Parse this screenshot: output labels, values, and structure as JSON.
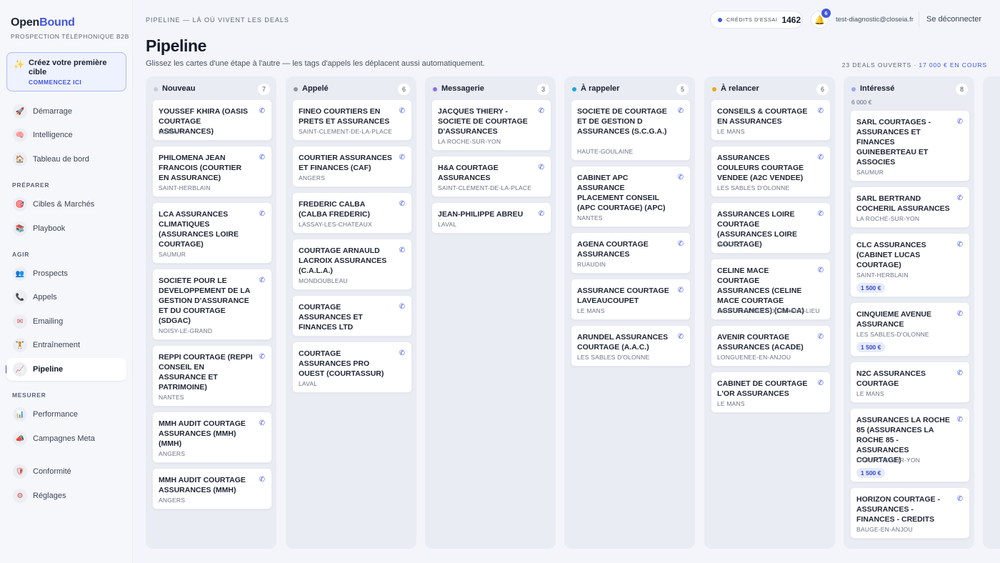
{
  "app": {
    "brand_part1": "Open",
    "brand_part2": "Bound",
    "tagline": "PROSPECTION TÉLÉPHONIQUE B2B"
  },
  "promo": {
    "title": "Créez votre première cible",
    "cta": "COMMENCEZ ICI",
    "icon": "sparkles-icon"
  },
  "sidebar": {
    "top_items": [
      {
        "label": "Démarrage",
        "icon": "rocket-icon"
      },
      {
        "label": "Intelligence",
        "icon": "brain-icon"
      },
      {
        "label": "Tableau de bord",
        "icon": "home-icon"
      }
    ],
    "sections": [
      {
        "label": "PRÉPARER",
        "items": [
          {
            "label": "Cibles & Marchés",
            "icon": "target-icon"
          },
          {
            "label": "Playbook",
            "icon": "books-icon"
          }
        ]
      },
      {
        "label": "AGIR",
        "items": [
          {
            "label": "Prospects",
            "icon": "people-icon"
          },
          {
            "label": "Appels",
            "icon": "phone-icon"
          },
          {
            "label": "Emailing",
            "icon": "envelope-icon"
          },
          {
            "label": "Entraînement",
            "icon": "dumbbell-icon"
          },
          {
            "label": "Pipeline",
            "icon": "chart-up-icon"
          }
        ]
      },
      {
        "label": "MESURER",
        "items": [
          {
            "label": "Performance",
            "icon": "bar-chart-icon"
          },
          {
            "label": "Campagnes Meta",
            "icon": "megaphone-icon"
          }
        ]
      }
    ],
    "bottom_items": [
      {
        "label": "Conformité",
        "icon": "shield-icon"
      },
      {
        "label": "Réglages",
        "icon": "gear-icon"
      }
    ]
  },
  "header": {
    "breadcrumb": "PIPELINE — LÀ OÙ VIVENT LES DEALS",
    "credits_label": "CRÉDITS D'ESSAI",
    "credits_value": "1462",
    "notifications_count": "6",
    "user_email": "test-diagnostic@closeia.fr",
    "logout": "Se déconnecter"
  },
  "page": {
    "title": "Pipeline",
    "subtitle": "Glissez les cartes d'une étape à l'autre — les tags d'appels les déplacent aussi automatiquement.",
    "summary_count": "23 DEALS OUVERTS · ",
    "summary_amount": "17 000 € EN COURS"
  },
  "columns": [
    {
      "name": "Nouveau",
      "count": "7",
      "color": "#c9cdd8",
      "cards": [
        {
          "title": "YOUSSEF KHIRA (OASIS COURTAGE ASSURANCES)",
          "city": "LE MANS"
        },
        {
          "title": "PHILOMENA JEAN FRANCOIS (COURTIER EN ASSURANCE)",
          "city": "SAINT-HERBLAIN"
        },
        {
          "title": "LCA ASSURANCES CLIMATIQUES (ASSURANCES LOIRE COURTAGE)",
          "city": "SAUMUR"
        },
        {
          "title": "SOCIETE POUR LE DEVELOPPEMENT DE LA GESTION D'ASSURANCE ET DU COURTAGE (SDGAC)",
          "city": "NOISY-LE-GRAND"
        },
        {
          "title": "REPPI COURTAGE (REPPI CONSEIL EN ASSURANCE ET PATRIMOINE)",
          "city": "NANTES"
        },
        {
          "title": "MMH AUDIT COURTAGE ASSURANCES (MMH) (MMH)",
          "city": "ANGERS"
        },
        {
          "title": "MMH AUDIT COURTAGE ASSURANCES (MMH)",
          "city": "ANGERS"
        }
      ]
    },
    {
      "name": "Appelé",
      "count": "6",
      "color": "#8c93a3",
      "cards": [
        {
          "title": "FINEO COURTIERS EN PRETS ET ASSURANCES",
          "city": "SAINT-CLEMENT-DE-LA-PLACE"
        },
        {
          "title": "COURTIER ASSURANCES ET FINANCES (CAF)",
          "city": "ANGERS"
        },
        {
          "title": "FREDERIC CALBA (CALBA FREDERIC)",
          "city": "LASSAY-LES-CHATEAUX"
        },
        {
          "title": "COURTAGE ARNAULD LACROIX ASSURANCES (C.A.L.A.)",
          "city": "MONDOUBLEAU"
        },
        {
          "title": "COURTAGE ASSURANCES ET FINANCES LTD",
          "city": "—"
        },
        {
          "title": "COURTAGE ASSURANCES PRO OUEST (COURTASSUR)",
          "city": "LAVAL"
        }
      ]
    },
    {
      "name": "Messagerie",
      "count": "3",
      "color": "#8b6fe8",
      "cards": [
        {
          "title": "JACQUES THIERY - SOCIETE DE COURTAGE D'ASSURANCES",
          "city": "LA ROCHE-SUR-YON"
        },
        {
          "title": "H&A COURTAGE ASSURANCES",
          "city": "SAINT-CLEMENT-DE-LA-PLACE"
        },
        {
          "title": "JEAN-PHILIPPE ABREU",
          "city": "LAVAL"
        }
      ]
    },
    {
      "name": "À rappeler",
      "count": "5",
      "color": "#1aa7e0",
      "cards": [
        {
          "title": "SOCIETE DE COURTAGE ET DE GESTION D ASSURANCES (S.C.G.A.)",
          "city": "HAUTE-GOULAINE"
        },
        {
          "title": "CABINET APC ASSURANCE PLACEMENT CONSEIL (APC COURTAGE) (APC)",
          "city": "NANTES"
        },
        {
          "title": "AGENA COURTAGE ASSURANCES",
          "city": "RUAUDIN"
        },
        {
          "title": "ASSURANCE COURTAGE LAVEAUCOUPET",
          "city": "LE MANS"
        },
        {
          "title": "ARUNDEL ASSURANCES COURTAGE (A.A.C.)",
          "city": "LES SABLES D'OLONNE"
        }
      ]
    },
    {
      "name": "À relancer",
      "count": "6",
      "color": "#f0a818",
      "cards": [
        {
          "title": "CONSEILS & COURTAGE EN ASSURANCES",
          "city": "LE MANS"
        },
        {
          "title": "ASSURANCES COULEURS COURTAGE VENDEE (A2C VENDEE)",
          "city": "LES SABLES D'OLONNE"
        },
        {
          "title": "ASSURANCES LOIRE COURTAGE (ASSURANCES LOIRE COURTAGE)",
          "city": "NANTES"
        },
        {
          "title": "CELINE MACE COURTAGE ASSURANCES (CELINE MACE COURTAGE ASSURANCES) (CM-CA)",
          "city": "SAINT-PHILBERT-DE-GRAND-LIEU"
        },
        {
          "title": "AVENIR COURTAGE ASSURANCES (ACADE)",
          "city": "LONGUENEE-EN-ANJOU"
        },
        {
          "title": "CABINET DE COURTAGE L'OR ASSURANCES",
          "city": "LE MANS"
        }
      ]
    },
    {
      "name": "Intéressé",
      "count": "8",
      "color": "#9aa8f0",
      "sum": "6 000 €",
      "cards": [
        {
          "title": "SARL COURTAGES - ASSURANCES ET FINANCES GUINEBERTEAU ET ASSOCIES",
          "city": "SAUMUR"
        },
        {
          "title": "SARL BERTRAND COCHERIL ASSURANCES",
          "city": "LA ROCHE-SUR-YON"
        },
        {
          "title": "CLC ASSURANCES (CABINET LUCAS COURTAGE)",
          "city": "SAINT-HERBLAIN",
          "amount": "1 500 €"
        },
        {
          "title": "CINQUIEME AVENUE ASSURANCE",
          "city": "LES SABLES-D'OLONNE",
          "amount": "1 500 €"
        },
        {
          "title": "N2C ASSURANCES COURTAGE",
          "city": "LE MANS"
        },
        {
          "title": "ASSURANCES LA ROCHE 85 (ASSURANCES LA ROCHE 85 - ASSURANCES COURTAGE)",
          "city": "LA-ROCHE-SUR-YON",
          "amount": "1 500 €"
        },
        {
          "title": "HORIZON COURTAGE - ASSURANCES - FINANCES - CREDITS",
          "city": "BAUGE-EN-ANJOU"
        }
      ]
    }
  ]
}
